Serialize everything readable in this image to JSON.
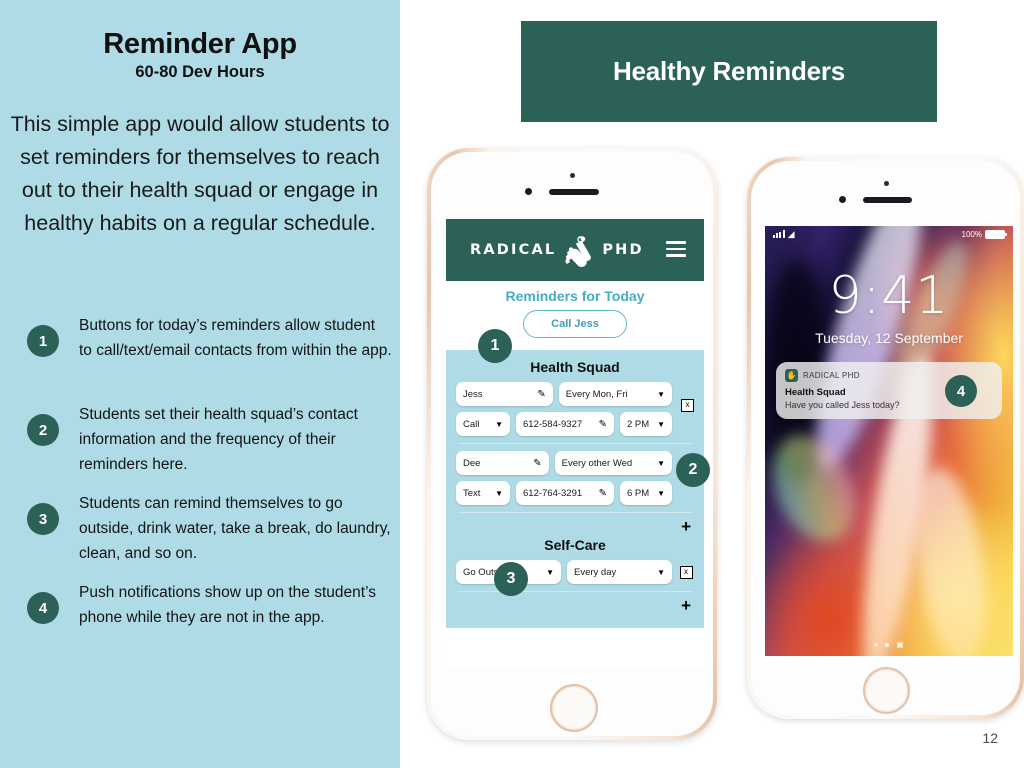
{
  "left": {
    "title": "Reminder App",
    "subtitle": "60-80 Dev Hours",
    "intro": "This simple app would allow students to set reminders for themselves to reach out to their health squad or engage in healthy habits on a regular schedule.",
    "bullets": [
      {
        "num": "1",
        "text": "Buttons for today’s reminders allow student to call/text/email contacts from within the app."
      },
      {
        "num": "2",
        "text": "Students set their health squad’s contact information and the frequency of their reminders here."
      },
      {
        "num": "3",
        "text": "Students can remind themselves to go outside, drink water, take a break, do laundry, clean, and so on."
      },
      {
        "num": "4",
        "text": "Push notifications show up on the student’s phone while they are not in the app."
      }
    ]
  },
  "banner": {
    "title": "Healthy Reminders"
  },
  "app": {
    "logo_left": "RADICAL",
    "logo_right": "PHD",
    "menu_icon": "hamburger-menu-icon",
    "today": {
      "heading": "Reminders for Today",
      "reminder_button": "Call Jess"
    },
    "health_squad": {
      "heading": "Health Squad",
      "contacts": [
        {
          "name": "Jess",
          "frequency": "Every Mon, Fri",
          "method": "Call",
          "phone": "612-584-9327",
          "time": "2 PM",
          "remove": "x"
        },
        {
          "name": "Dee",
          "frequency": "Every other Wed",
          "method": "Text",
          "phone": "612-764-3291",
          "time": "6 PM",
          "remove": "x"
        }
      ],
      "add": "+"
    },
    "self_care": {
      "heading": "Self-Care",
      "items": [
        {
          "activity": "Go Outside",
          "frequency": "Every day",
          "remove": "x"
        }
      ],
      "add": "+"
    }
  },
  "lockscreen": {
    "signal": "cellular-signal-icon",
    "wifi": "▲",
    "battery_pct": "100%",
    "time": "9:41",
    "date": "Tuesday, 12 September",
    "notification": {
      "app_name": "RADICAL PHD",
      "title": "Health Squad",
      "body": "Have you called Jess today?",
      "badge": "4"
    }
  },
  "callouts": {
    "one": "1",
    "two": "2",
    "three": "3"
  },
  "page_number": "12",
  "colors": {
    "teal": "#2c6158",
    "light_blue": "#aedbe5",
    "accent_blue": "#45aec2",
    "white": "#ffffff"
  }
}
